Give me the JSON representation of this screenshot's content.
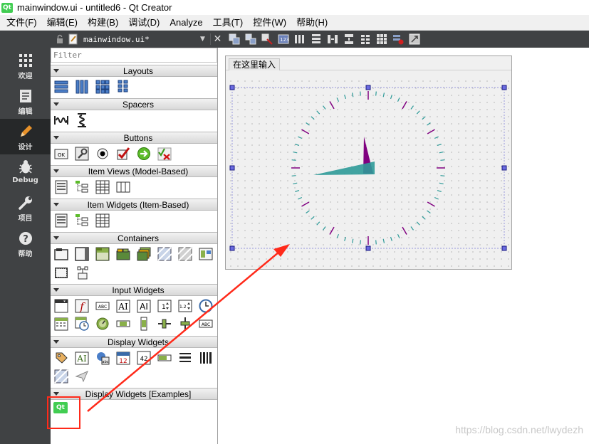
{
  "window": {
    "title": "mainwindow.ui - untitled6 - Qt Creator",
    "logo_text": "Qt"
  },
  "menu": [
    "文件(F)",
    "编辑(E)",
    "构建(B)",
    "调试(D)",
    "Analyze",
    "工具(T)",
    "控件(W)",
    "帮助(H)"
  ],
  "modes": [
    {
      "label": "欢迎",
      "icon": "grid-icon"
    },
    {
      "label": "编辑",
      "icon": "document-icon"
    },
    {
      "label": "设计",
      "icon": "pencil-icon",
      "active": true
    },
    {
      "label": "Debug",
      "icon": "bug-icon"
    },
    {
      "label": "项目",
      "icon": "wrench-icon"
    },
    {
      "label": "帮助",
      "icon": "help-icon"
    }
  ],
  "editor": {
    "filename": "mainwindow.ui*"
  },
  "widgetbox": {
    "filter_placeholder": "Filter",
    "categories": [
      {
        "label": "Layouts"
      },
      {
        "label": "Spacers"
      },
      {
        "label": "Buttons"
      },
      {
        "label": "Item Views (Model-Based)"
      },
      {
        "label": "Item Widgets (Item-Based)"
      },
      {
        "label": "Containers"
      },
      {
        "label": "Input Widgets"
      },
      {
        "label": "Display Widgets"
      },
      {
        "label": "Display Widgets [Examples]"
      }
    ],
    "custom_widget_label": "Qt"
  },
  "form": {
    "menu_placeholder": "在这里输入"
  },
  "watermark": "https://blog.csdn.net/lwydezh",
  "colors": {
    "accent_teal": "#2e9a98",
    "accent_purple": "#800080",
    "highlight_red": "#ff2a1a"
  }
}
